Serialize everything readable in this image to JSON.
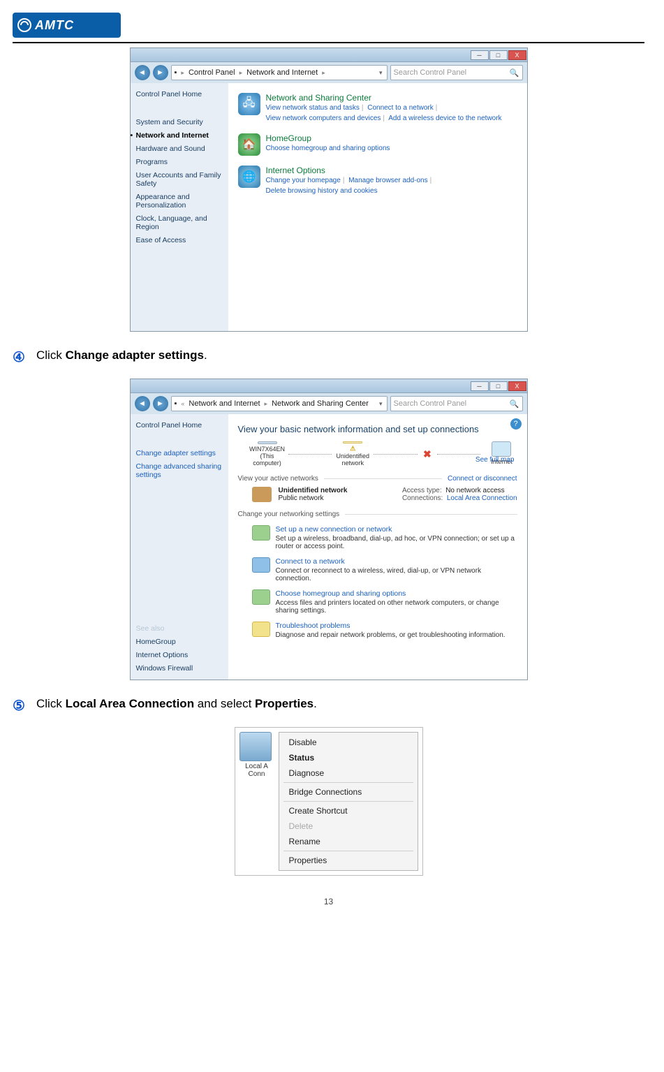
{
  "logo": {
    "text": "AMTC"
  },
  "step4": {
    "num": "④",
    "pre": "Click ",
    "bold": "Change adapter settings",
    "post": "."
  },
  "step5": {
    "num": "⑤",
    "pre": "Click ",
    "bold1": "Local Area Connection",
    "mid": " and select ",
    "bold2": "Properties",
    "post": "."
  },
  "win1": {
    "breadcrumb": [
      "Control Panel",
      "Network and Internet"
    ],
    "search_placeholder": "Search Control Panel",
    "sidebar": [
      "Control Panel Home",
      "System and Security",
      "Network and Internet",
      "Hardware and Sound",
      "Programs",
      "User Accounts and Family Safety",
      "Appearance and Personalization",
      "Clock, Language, and Region",
      "Ease of Access"
    ],
    "groups": [
      {
        "title": "Network and Sharing Center",
        "links": [
          "View network status and tasks",
          "Connect to a network",
          "View network computers and devices",
          "Add a wireless device to the network"
        ]
      },
      {
        "title": "HomeGroup",
        "links": [
          "Choose homegroup and sharing options"
        ]
      },
      {
        "title": "Internet Options",
        "links": [
          "Change your homepage",
          "Manage browser add-ons",
          "Delete browsing history and cookies"
        ]
      }
    ]
  },
  "win2": {
    "breadcrumb": [
      "Network and Internet",
      "Network and Sharing Center"
    ],
    "search_placeholder": "Search Control Panel",
    "sidebar_top": [
      "Control Panel Home"
    ],
    "sidebar_links": [
      "Change adapter settings",
      "Change advanced sharing settings"
    ],
    "sidebar_seealso_label": "See also",
    "sidebar_seealso": [
      "HomeGroup",
      "Internet Options",
      "Windows Firewall"
    ],
    "heading": "View your basic network information and set up connections",
    "fullmap": "See full map",
    "nodes": {
      "pc": "WIN7X64EN",
      "pc_sub": "(This computer)",
      "mid": "Unidentified network",
      "net": "Internet"
    },
    "active_label": "View your active networks",
    "conn_or_disc": "Connect or disconnect",
    "active": {
      "name": "Unidentified network",
      "type": "Public network",
      "access_label": "Access type:",
      "access_val": "No network access",
      "conn_label": "Connections:",
      "conn_val": "Local Area Connection"
    },
    "change_label": "Change your networking settings",
    "tasks": [
      {
        "title": "Set up a new connection or network",
        "desc": "Set up a wireless, broadband, dial-up, ad hoc, or VPN connection; or set up a router or access point."
      },
      {
        "title": "Connect to a network",
        "desc": "Connect or reconnect to a wireless, wired, dial-up, or VPN network connection."
      },
      {
        "title": "Choose homegroup and sharing options",
        "desc": "Access files and printers located on other network computers, or change sharing settings."
      },
      {
        "title": "Troubleshoot problems",
        "desc": "Diagnose and repair network problems, or get troubleshooting information."
      }
    ]
  },
  "ctx": {
    "icon_label1": "Local A",
    "icon_label2": "Conn",
    "items": [
      {
        "label": "Disable",
        "type": "normal"
      },
      {
        "label": "Status",
        "type": "bold"
      },
      {
        "label": "Diagnose",
        "type": "normal"
      },
      {
        "sep": true
      },
      {
        "label": "Bridge Connections",
        "type": "normal"
      },
      {
        "sep": true
      },
      {
        "label": "Create Shortcut",
        "type": "normal"
      },
      {
        "label": "Delete",
        "type": "disabled"
      },
      {
        "label": "Rename",
        "type": "normal"
      },
      {
        "sep": true
      },
      {
        "label": "Properties",
        "type": "normal"
      }
    ]
  },
  "page_number": "13"
}
